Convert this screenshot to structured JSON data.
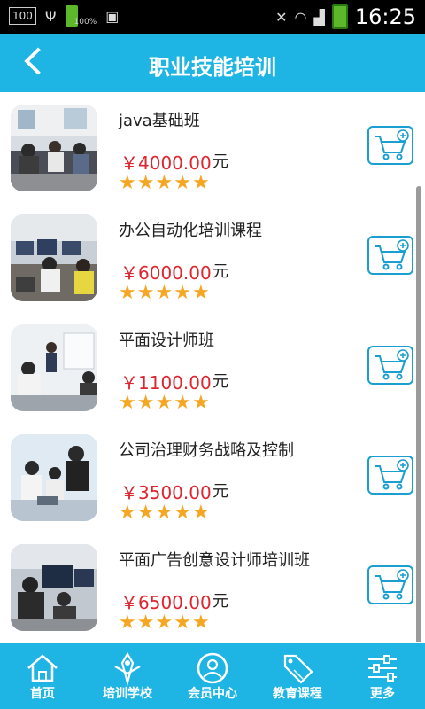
{
  "status": {
    "left_box": "100",
    "battery_pct": "100%",
    "time": "16:25"
  },
  "header": {
    "title": "职业技能培训"
  },
  "items": [
    {
      "name": "java基础班",
      "price": "￥4000.00",
      "unit": "元",
      "rating": 5
    },
    {
      "name": "办公自动化培训课程",
      "price": "￥6000.00",
      "unit": "元",
      "rating": 5
    },
    {
      "name": "平面设计师班",
      "price": "￥1100.00",
      "unit": "元",
      "rating": 5
    },
    {
      "name": "公司治理财务战略及控制",
      "price": "￥3500.00",
      "unit": "元",
      "rating": 5
    },
    {
      "name": "平面广告创意设计师培训班",
      "price": "￥6500.00",
      "unit": "元",
      "rating": 5
    }
  ],
  "tabs": [
    {
      "label": "首页",
      "icon": "home-icon"
    },
    {
      "label": "培训学校",
      "icon": "school-icon"
    },
    {
      "label": "会员中心",
      "icon": "member-icon"
    },
    {
      "label": "教育课程",
      "icon": "sale-tag-icon"
    },
    {
      "label": "更多",
      "icon": "settings-sliders-icon"
    }
  ],
  "colors": {
    "accent": "#1eb4e3",
    "price": "#e0252f",
    "star": "#f5a623",
    "cart_border": "#1a9fd0"
  }
}
